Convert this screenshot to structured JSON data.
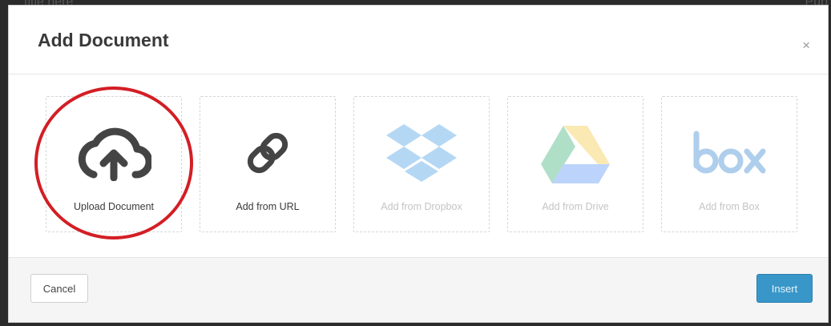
{
  "backdrop": {
    "left_text": "title here",
    "right_text": "Pub"
  },
  "dialog": {
    "title": "Add Document",
    "close_glyph": "×",
    "tiles": [
      {
        "label": "Upload Document",
        "icon": "cloud-upload-icon",
        "enabled": true
      },
      {
        "label": "Add from URL",
        "icon": "link-icon",
        "enabled": true
      },
      {
        "label": "Add from Dropbox",
        "icon": "dropbox-icon",
        "enabled": false
      },
      {
        "label": "Add from Drive",
        "icon": "google-drive-icon",
        "enabled": false
      },
      {
        "label": "Add from Box",
        "icon": "box-icon",
        "enabled": false
      }
    ],
    "highlighted_tile": "Upload Document",
    "footer": {
      "cancel_label": "Cancel",
      "insert_label": "Insert"
    }
  },
  "colors": {
    "highlight_ring": "#d31e25",
    "insert_button": "#3897c8",
    "dropbox_blue": "#2a8fe0",
    "box_blue": "#1a74c9"
  }
}
